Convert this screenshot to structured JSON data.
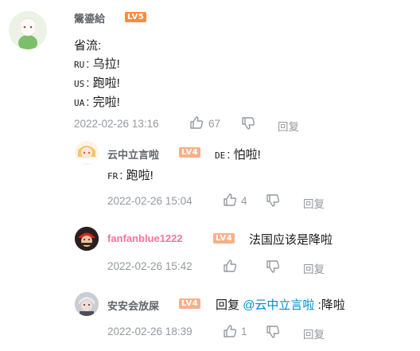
{
  "main_comment": {
    "username": "鬶鎏給",
    "level": "LV5",
    "lines": [
      {
        "text": "省流:"
      },
      {
        "code": "RU",
        "text": "乌拉!"
      },
      {
        "code": "US",
        "text": "跑啦!"
      },
      {
        "code": "UA",
        "text": "完啦!"
      }
    ],
    "time": "2022-02-26 13:16",
    "likes": "67",
    "reply_label": "回复"
  },
  "replies": [
    {
      "username": "云中立言啦",
      "level": "LV4",
      "line1_code": "DE",
      "line1_text": "怕啦!",
      "line2_code": "FR",
      "line2_text": "跑啦!",
      "time": "2022-02-26 15:04",
      "likes": "4",
      "reply_label": "回复"
    },
    {
      "username": "fanfanblue1222",
      "level": "LV4",
      "text": "法国应该是降啦",
      "time": "2022-02-26 15:42",
      "reply_label": "回复"
    },
    {
      "username": "安安会放屎",
      "level": "LV4",
      "prefix": "回复",
      "mention": "@云中立言啦",
      "suffix": ":降啦",
      "time": "2022-02-26 18:39",
      "likes": "1",
      "reply_label": "回复"
    }
  ],
  "colors": {
    "accent_link": "#008ac5",
    "vip_name": "#fb7299",
    "lv5": "#ff8b3d",
    "lv4": "#f6b08a"
  }
}
